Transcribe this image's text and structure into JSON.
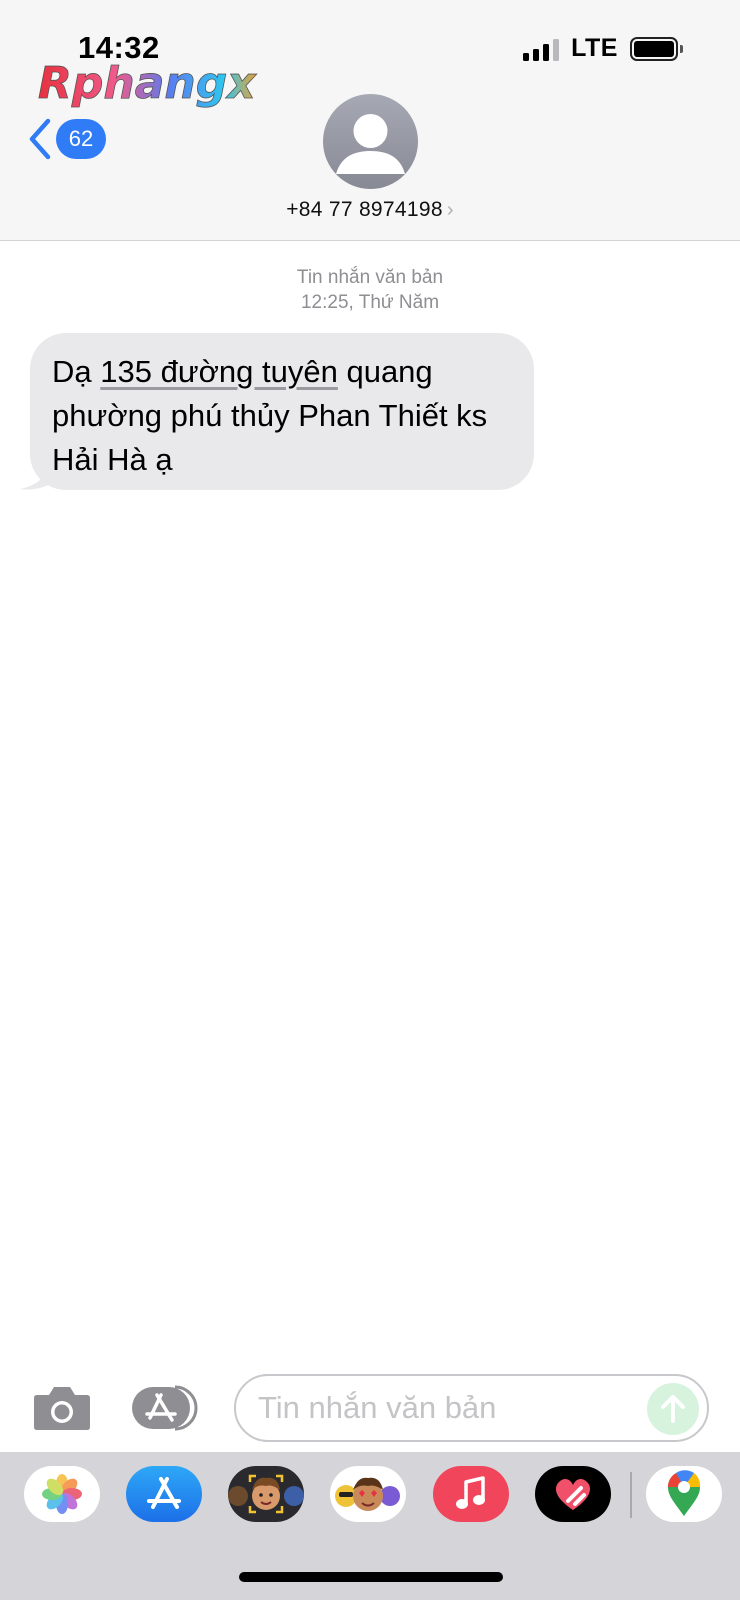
{
  "status_bar": {
    "time": "14:32",
    "network": "LTE"
  },
  "watermark": {
    "text": "Rphangx"
  },
  "header": {
    "unread_count": "62",
    "contact_phone": "+84 77 8974198",
    "contact_chevron": "›"
  },
  "conversation": {
    "message_type": "Tin nhắn văn bản",
    "timestamp": "12:25, Thứ Năm",
    "messages": [
      {
        "direction": "incoming",
        "text_before_link": "Dạ ",
        "link_text": "135 đường tuyên",
        "text_after_link": " quang phường phú thủy Phan Thiết ks Hải Hà ạ"
      }
    ]
  },
  "composer": {
    "placeholder": "Tin nhắn văn bản"
  },
  "app_drawer": {
    "apps": [
      "photos-icon",
      "app-store-icon",
      "memoji-icon",
      "animoji-icon",
      "music-icon",
      "digital-touch-icon",
      "maps-icon"
    ]
  },
  "colors": {
    "accent_blue": "#2f7cf6",
    "bubble_gray": "#e9e9eb",
    "header_bg": "#f6f6f6",
    "meta_gray": "#8e8e93",
    "send_green_disabled": "#d7f3dd",
    "drawer_bg": "#d5d5d9"
  }
}
